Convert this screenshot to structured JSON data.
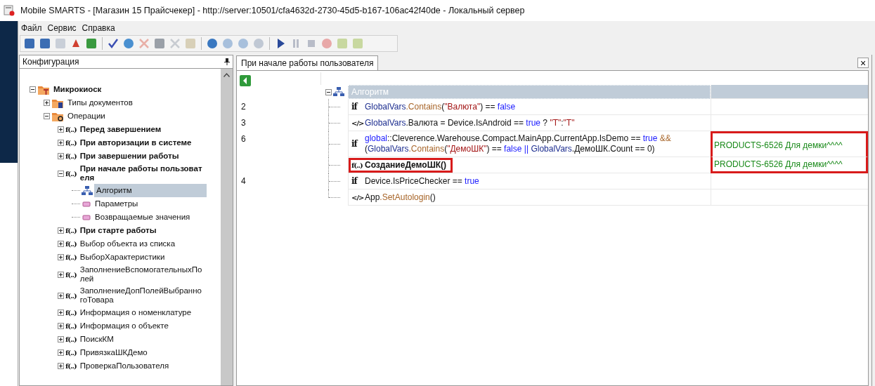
{
  "window": {
    "title": "Mobile SMARTS - [Магазин 15 Прайсчекер] - http://server:10501/cfa4632d-2730-45d5-b167-106ac42f40de - Локальный сервер"
  },
  "menu": [
    "Файл",
    "Сервис",
    "Справка"
  ],
  "config_panel": {
    "title": "Конфигурация",
    "tree": [
      {
        "label": "Микрокиоск",
        "kind": "config",
        "bold": true,
        "expanded": true,
        "selected": false,
        "children": [
          {
            "label": "Типы документов",
            "kind": "doc-folder",
            "bold": false,
            "expanded": false,
            "selected": false
          },
          {
            "label": "Операции",
            "kind": "func-folder",
            "bold": false,
            "expanded": true,
            "selected": false,
            "children": [
              {
                "label": "Перед завершением",
                "kind": "function",
                "glyph": "f(..)",
                "bold": true,
                "expanded": false,
                "selected": false
              },
              {
                "label": "При авторизации в системе",
                "kind": "function",
                "glyph": "f(..)",
                "bold": true,
                "expanded": false,
                "selected": false
              },
              {
                "label": "При завершении работы",
                "kind": "function",
                "glyph": "f(..)",
                "bold": true,
                "expanded": false,
                "selected": false
              },
              {
                "label": "При начале работы пользователя",
                "kind": "function",
                "glyph": "f(..)",
                "bold": true,
                "expanded": true,
                "selected": false,
                "children": [
                  {
                    "label": "Алгоритм",
                    "kind": "algorithm",
                    "bold": false,
                    "selected": true
                  },
                  {
                    "label": "Параметры",
                    "kind": "parameter",
                    "bold": false,
                    "selected": false
                  },
                  {
                    "label": "Возвращаемые значения",
                    "kind": "parameter",
                    "bold": false,
                    "selected": false
                  }
                ]
              },
              {
                "label": "При старте работы",
                "kind": "function",
                "glyph": "f(..)",
                "bold": true,
                "expanded": false,
                "selected": false
              },
              {
                "label": "Выбор объекта из списка",
                "kind": "function",
                "glyph": "f(..)",
                "bold": false,
                "expanded": false,
                "selected": false
              },
              {
                "label": "ВыборХарактеристики",
                "kind": "function",
                "glyph": "f(..)",
                "bold": false,
                "expanded": false,
                "selected": false
              },
              {
                "label": "ЗаполнениеВспомогательныхПолей",
                "kind": "function",
                "glyph": "f(..)",
                "bold": false,
                "expanded": false,
                "selected": false
              },
              {
                "label": "ЗаполнениеДопПолейВыбранногоТовара",
                "kind": "function",
                "glyph": "f(..)",
                "bold": false,
                "expanded": false,
                "selected": false
              },
              {
                "label": "Информация о номенклатуре",
                "kind": "function",
                "glyph": "f(..)",
                "bold": false,
                "expanded": false,
                "selected": false
              },
              {
                "label": "Информация о объекте",
                "kind": "function",
                "glyph": "f(..)",
                "bold": false,
                "expanded": false,
                "selected": false
              },
              {
                "label": "ПоискКМ",
                "kind": "function",
                "glyph": "f(..)",
                "bold": false,
                "expanded": false,
                "selected": false
              },
              {
                "label": "ПривязкаШКДемо",
                "kind": "function",
                "glyph": "f(..)",
                "bold": false,
                "expanded": false,
                "selected": false
              },
              {
                "label": "ПроверкаПользователя",
                "kind": "function",
                "glyph": "f(..)",
                "bold": false,
                "expanded": false,
                "selected": false
              }
            ]
          }
        ]
      }
    ]
  },
  "tabs": [
    {
      "label": "При начале работы пользователя",
      "selected": true
    }
  ],
  "close_glyph": "×",
  "editor": {
    "root": {
      "label": "Алгоритм",
      "expanded": true,
      "selected": true
    },
    "rows": [
      {
        "line": "2",
        "glyph": "if",
        "bold": false,
        "highlighted": false,
        "comment_boxed": false,
        "lines": [
          [
            {
              "text": "GlobalVars",
              "kind": "ident"
            },
            {
              "text": ".Contains",
              "kind": "member"
            },
            {
              "text": "(",
              "kind": "plain"
            },
            {
              "text": "\"Валюта\"",
              "kind": "string"
            },
            {
              "text": ") == ",
              "kind": "plain"
            },
            {
              "text": "false",
              "kind": "keyword"
            }
          ]
        ]
      },
      {
        "line": "3",
        "glyph": "</>",
        "bold": false,
        "highlighted": false,
        "comment_boxed": false,
        "lines": [
          [
            {
              "text": "GlobalVars",
              "kind": "ident"
            },
            {
              "text": ".Валюта = Device.IsAndroid == ",
              "kind": "plain"
            },
            {
              "text": "true",
              "kind": "keyword"
            },
            {
              "text": " ? ",
              "kind": "plain"
            },
            {
              "text": "\"Т\"",
              "kind": "string"
            },
            {
              "text": ":",
              "kind": "plain"
            },
            {
              "text": "\"Т\"",
              "kind": "string"
            }
          ]
        ]
      },
      {
        "line": "6",
        "glyph": "if",
        "bold": false,
        "highlighted": false,
        "comment": "PRODUCTS-6526 Для демки^^^^",
        "comment_boxed": true,
        "lines": [
          [
            {
              "text": "global",
              "kind": "keyword"
            },
            {
              "text": "::Cleverence.Warehouse.Compact.MainApp.CurrentApp.IsDemo == ",
              "kind": "plain"
            },
            {
              "text": "true",
              "kind": "keyword"
            },
            {
              "text": " &&",
              "kind": "member"
            }
          ],
          [
            {
              "text": "(",
              "kind": "plain"
            },
            {
              "text": "GlobalVars",
              "kind": "ident"
            },
            {
              "text": ".Contains",
              "kind": "member"
            },
            {
              "text": "(",
              "kind": "plain"
            },
            {
              "text": "\"ДемоШК\"",
              "kind": "string"
            },
            {
              "text": ") == ",
              "kind": "plain"
            },
            {
              "text": "false",
              "kind": "keyword"
            },
            {
              "text": " || ",
              "kind": "keyword"
            },
            {
              "text": "GlobalVars",
              "kind": "ident"
            },
            {
              "text": ".ДемоШК.Count == 0)",
              "kind": "plain"
            }
          ]
        ]
      },
      {
        "glyph": "f(..)",
        "bold": true,
        "highlighted": true,
        "comment": "PRODUCTS-6526 Для демки^^^^",
        "comment_boxed": true,
        "lines": [
          [
            {
              "text": "СозданиеДемоШК()",
              "kind": "plain"
            }
          ]
        ]
      },
      {
        "line": "4",
        "glyph": "if",
        "bold": false,
        "highlighted": false,
        "comment_boxed": false,
        "lines": [
          [
            {
              "text": "Device.IsPriceChecker == ",
              "kind": "plain"
            },
            {
              "text": "true",
              "kind": "keyword"
            }
          ]
        ]
      },
      {
        "glyph": "</>",
        "bold": false,
        "highlighted": false,
        "comment_boxed": false,
        "lines": [
          [
            {
              "text": "App",
              "kind": "plain"
            },
            {
              "text": ".SetAutologin",
              "kind": "member"
            },
            {
              "text": "()",
              "kind": "plain"
            }
          ]
        ]
      }
    ]
  }
}
